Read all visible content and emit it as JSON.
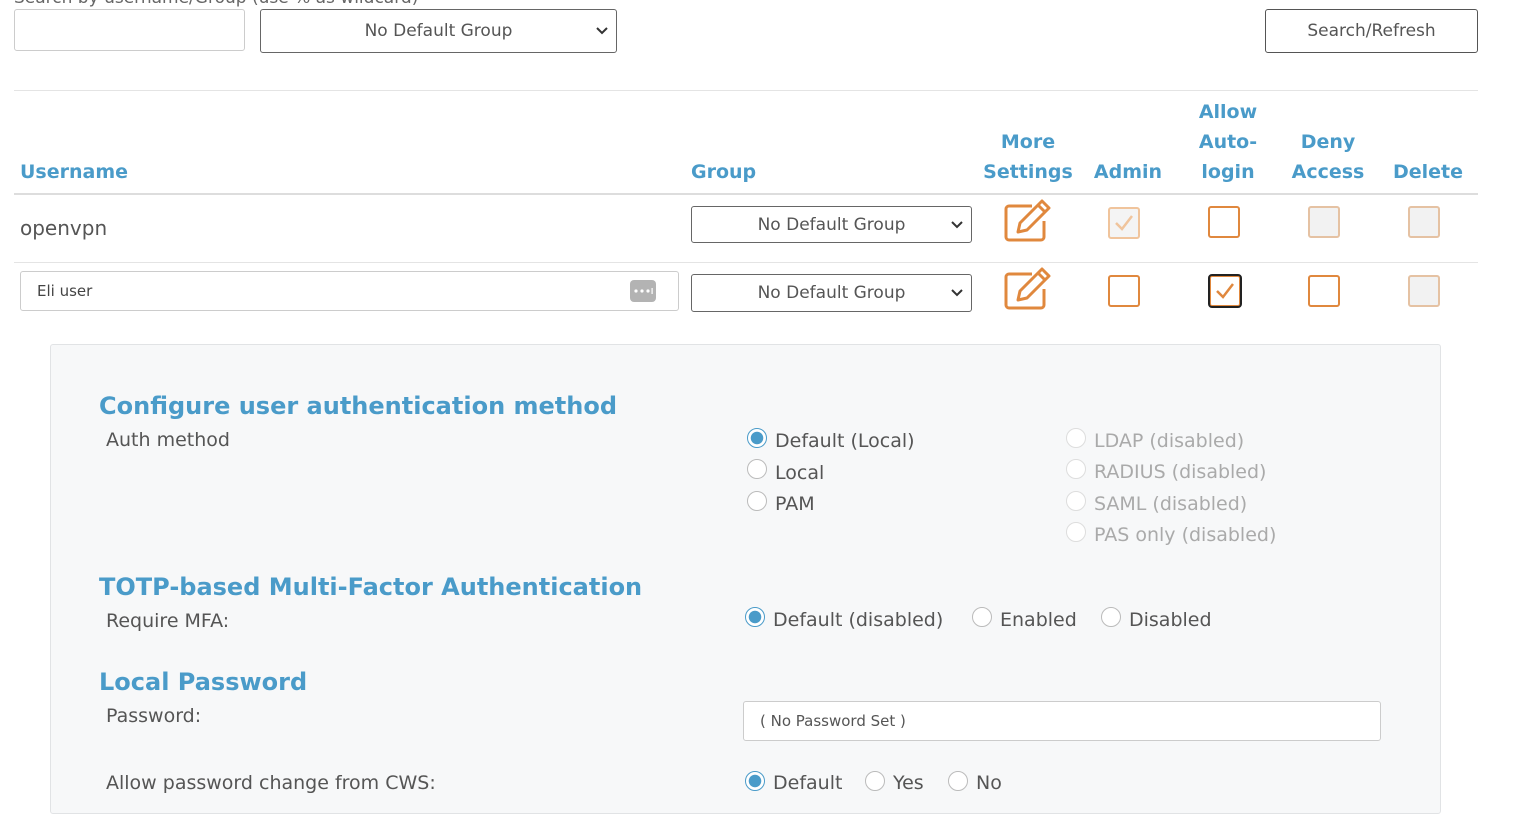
{
  "search": {
    "label": "Search by username/Group (use % as wildcard)",
    "username_value": "",
    "group_selected": "No Default Group",
    "refresh_label": "Search/Refresh"
  },
  "table": {
    "headers": {
      "username": "Username",
      "group": "Group",
      "more_settings": [
        "More",
        "Settings"
      ],
      "admin": "Admin",
      "auto_login": [
        "Allow",
        "Auto-",
        "login"
      ],
      "deny_access": [
        "Deny",
        "Access"
      ],
      "delete": "Delete"
    },
    "rows": [
      {
        "username": "openvpn",
        "group": "No Default Group",
        "admin": true,
        "auto_login": false,
        "deny_access": false,
        "delete": false
      },
      {
        "username": "Eli user",
        "group": "No Default Group",
        "admin": false,
        "auto_login": true,
        "deny_access": false,
        "delete": false
      }
    ]
  },
  "settings": {
    "auth": {
      "title": "Configure user authentication method",
      "label": "Auth method",
      "options_left": [
        "Default (Local)",
        "Local",
        "PAM"
      ],
      "options_right": [
        "LDAP (disabled)",
        "RADIUS (disabled)",
        "SAML (disabled)",
        "PAS only (disabled)"
      ],
      "selected": "Default (Local)"
    },
    "mfa": {
      "title": "TOTP-based Multi-Factor Authentication",
      "label": "Require MFA:",
      "options": [
        "Default (disabled)",
        "Enabled",
        "Disabled"
      ],
      "selected": "Default (disabled)"
    },
    "password": {
      "title": "Local Password",
      "label": "Password:",
      "placeholder": "( No Password Set )",
      "cws_label": "Allow password change from CWS:",
      "cws_options": [
        "Default",
        "Yes",
        "No"
      ],
      "cws_selected": "Default"
    }
  },
  "colors": {
    "accent_blue": "#4a9bc9",
    "accent_orange": "#e0883e"
  },
  "icons": [
    "chevron-down-icon",
    "edit-icon",
    "checkmark-icon",
    "password-dots-icon"
  ]
}
